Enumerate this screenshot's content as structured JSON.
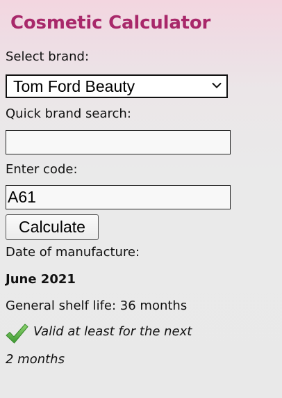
{
  "header": {
    "title": "Cosmetic Calculator"
  },
  "form": {
    "brand_label": "Select brand:",
    "brand_selected": "Tom Ford Beauty",
    "search_label": "Quick brand search:",
    "search_value": "",
    "code_label": "Enter code:",
    "code_value": "A61",
    "calculate_label": "Calculate"
  },
  "result": {
    "manufacture_label": "Date of manufacture:",
    "manufacture_date": "June 2021",
    "shelf_life": "General shelf life: 36 months",
    "validity_line1": "Valid at least for the next",
    "validity_line2": "2 months",
    "status_icon": "checkmark-icon"
  },
  "colors": {
    "title": "#a8286a",
    "check": "#5fb54a"
  }
}
